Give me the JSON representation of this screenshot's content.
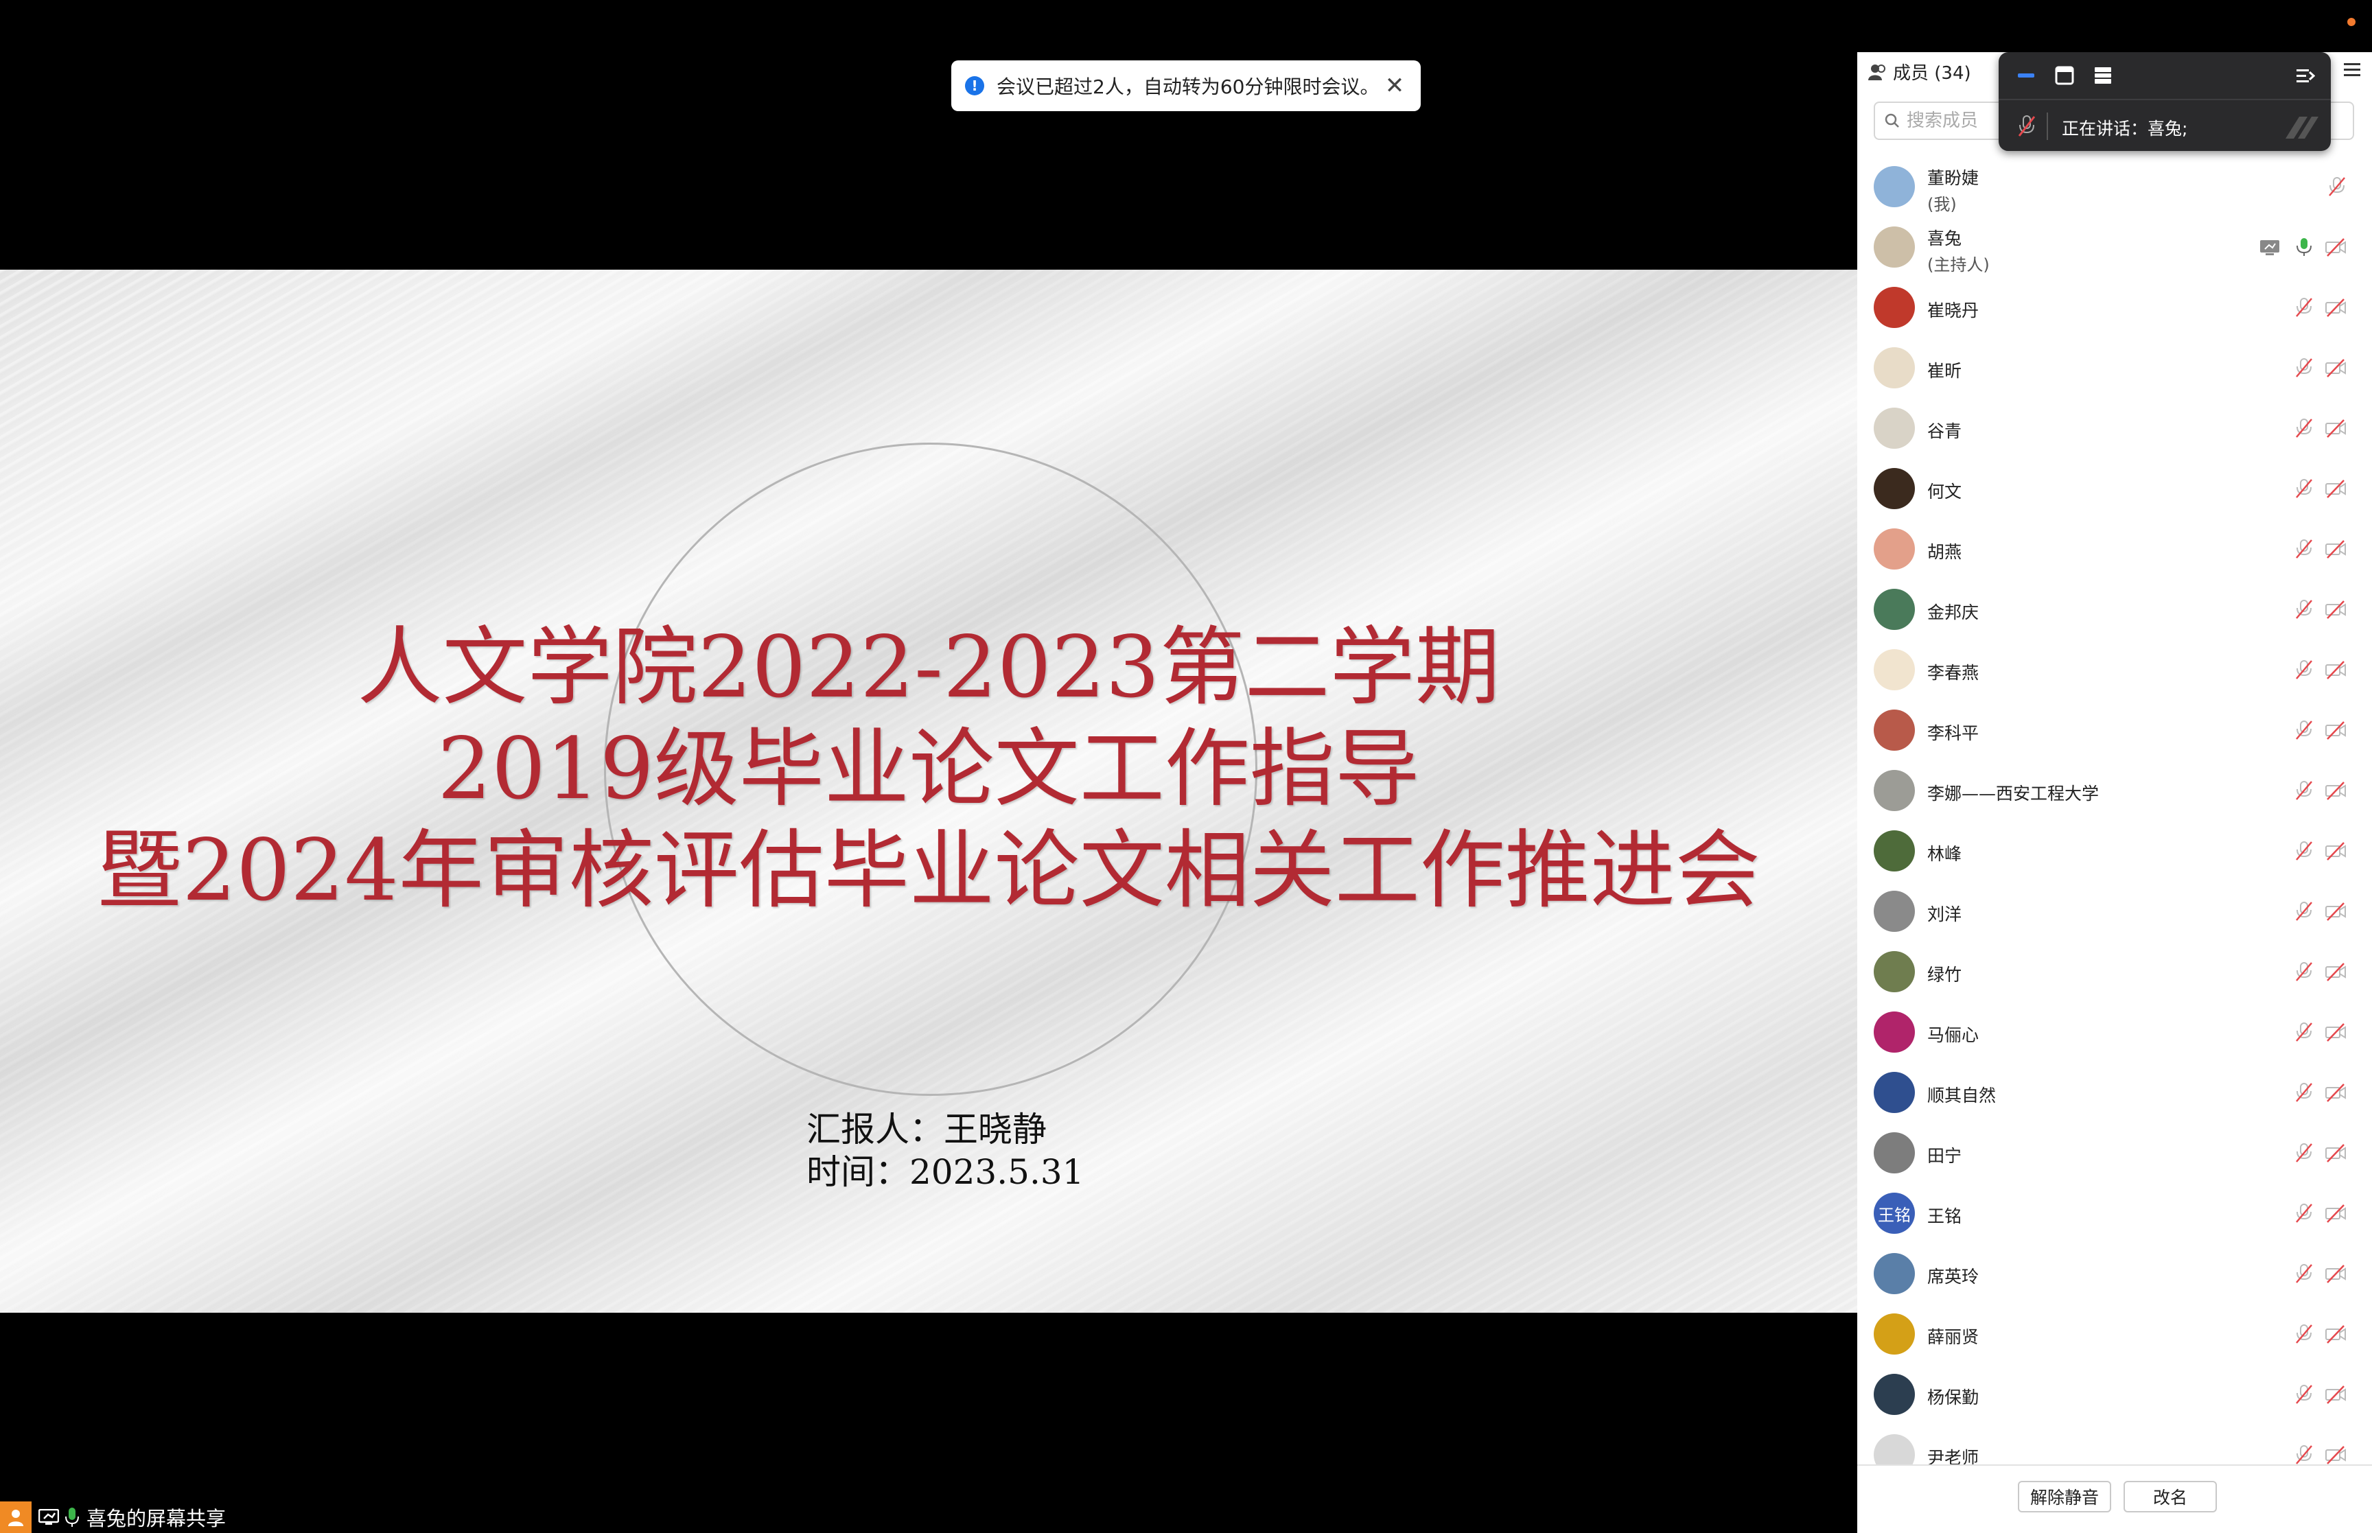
{
  "toast": {
    "icon": "info-icon",
    "text": "会议已超过2人，自动转为60分钟限时会议。"
  },
  "slide": {
    "title_line1": "人文学院2022-2023第二学期",
    "title_line2": "2019级毕业论文工作指导",
    "title_line3": "暨2024年审核评估毕业论文相关工作推进会",
    "reporter": "汇报人：王晓静",
    "time": "时间：2023.5.31",
    "title_color": "#b22a33"
  },
  "bottom_status": {
    "text": "喜兔的屏幕共享"
  },
  "sidebar": {
    "members_tab": "成员 (34)",
    "search_placeholder": "搜索成员",
    "members": [
      {
        "name": "董盼婕",
        "role": "(我)",
        "avatar_color": "#8fb3d9"
      },
      {
        "name": "喜兔",
        "role": "(主持人)",
        "avatar_color": "#cdbfa8"
      },
      {
        "name": "崔晓丹",
        "avatar_color": "#c0392b"
      },
      {
        "name": "崔昕",
        "avatar_color": "#e8dcc8"
      },
      {
        "name": "谷青",
        "avatar_color": "#d9d3c7"
      },
      {
        "name": "何文",
        "avatar_color": "#3b2a1e"
      },
      {
        "name": "胡燕",
        "avatar_color": "#e3a08a"
      },
      {
        "name": "金邦庆",
        "avatar_color": "#4a7a5a"
      },
      {
        "name": "李春燕",
        "avatar_color": "#f1e4cf"
      },
      {
        "name": "李科平",
        "avatar_color": "#b85a4a"
      },
      {
        "name": "李娜——西安工程大学",
        "avatar_color": "#9c9c96"
      },
      {
        "name": "林峰",
        "avatar_color": "#4e6b3a"
      },
      {
        "name": "刘洋",
        "avatar_color": "#8a8a8a"
      },
      {
        "name": "绿竹",
        "avatar_color": "#6f7d4f"
      },
      {
        "name": "马俪心",
        "avatar_color": "#b0246a"
      },
      {
        "name": "顺其自然",
        "avatar_color": "#2f4f8f"
      },
      {
        "name": "田宁",
        "avatar_color": "#7d7d7d"
      },
      {
        "name": "王铭",
        "avatar_text": "王铭",
        "avatar_color": "#3a5fb8"
      },
      {
        "name": "席英玲",
        "avatar_color": "#5a7fa8"
      },
      {
        "name": "薛丽贤",
        "avatar_color": "#d4a017"
      },
      {
        "name": "杨保勤",
        "avatar_color": "#2c3e50"
      },
      {
        "name": "尹老师",
        "avatar_color": "#d8d8d8"
      }
    ],
    "unmute_label": "解除静音",
    "rename_label": "改名"
  },
  "float_panel": {
    "speaking": "正在讲话：喜兔;"
  }
}
